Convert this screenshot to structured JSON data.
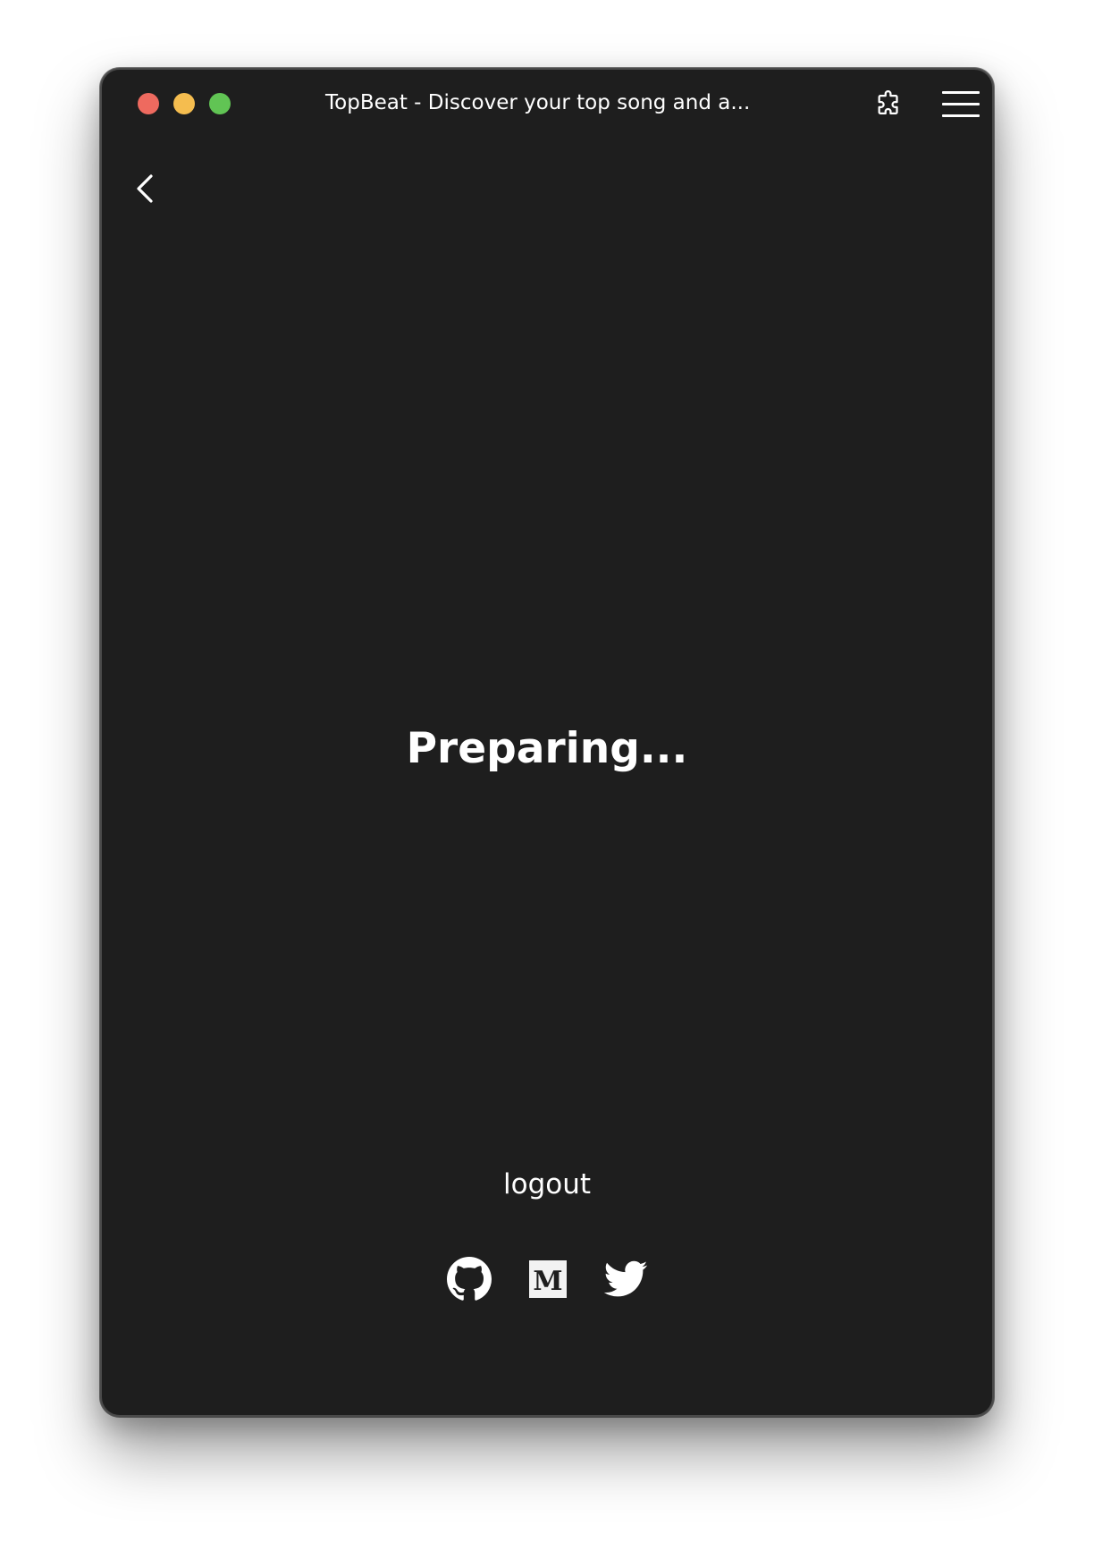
{
  "window": {
    "title": "TopBeat - Discover your top song and a...",
    "controls": {
      "close_color": "#ee6a5f",
      "minimize_color": "#f5bd4f",
      "zoom_color": "#61c454"
    },
    "extension_icon": "puzzle-piece-icon",
    "menu_icon": "hamburger-menu-icon"
  },
  "page": {
    "back_icon": "chevron-left-icon",
    "status_text": "Preparing...",
    "logout_label": "logout",
    "socials": [
      {
        "name": "GitHub",
        "icon": "github-icon"
      },
      {
        "name": "Medium",
        "icon": "medium-icon",
        "glyph": "M"
      },
      {
        "name": "Twitter",
        "icon": "twitter-icon"
      }
    ]
  },
  "colors": {
    "background": "#1e1e1e",
    "foreground": "#ffffff"
  }
}
